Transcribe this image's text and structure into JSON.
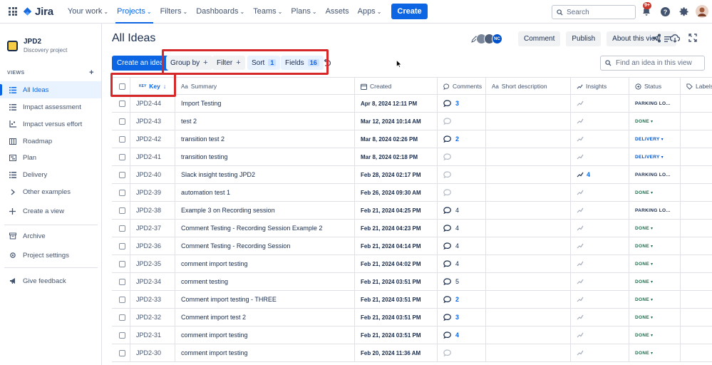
{
  "topnav": {
    "logo": "Jira",
    "items": [
      {
        "label": "Your work",
        "chevron": true
      },
      {
        "label": "Projects",
        "chevron": true,
        "active": true
      },
      {
        "label": "Filters",
        "chevron": true
      },
      {
        "label": "Dashboards",
        "chevron": true
      },
      {
        "label": "Teams",
        "chevron": true
      },
      {
        "label": "Plans",
        "chevron": true
      },
      {
        "label": "Assets",
        "chevron": false
      },
      {
        "label": "Apps",
        "chevron": true
      }
    ],
    "create": "Create",
    "search_placeholder": "Search",
    "notif_badge": "9+"
  },
  "sidebar": {
    "project_name": "JPD2",
    "project_type": "Discovery project",
    "views_header": "VIEWS",
    "views": [
      {
        "label": "All Ideas",
        "icon": "list-icon",
        "active": true
      },
      {
        "label": "Impact assessment",
        "icon": "list-icon"
      },
      {
        "label": "Impact versus effort",
        "icon": "matrix-icon"
      },
      {
        "label": "Roadmap",
        "icon": "board-icon"
      },
      {
        "label": "Plan",
        "icon": "timeline-icon"
      },
      {
        "label": "Delivery",
        "icon": "list-icon"
      },
      {
        "label": "Other examples",
        "icon": "chevron-right-icon"
      },
      {
        "label": "Create a view",
        "icon": "plus-icon"
      }
    ],
    "archive": "Archive",
    "settings": "Project settings",
    "feedback": "Give feedback"
  },
  "main": {
    "title": "All Ideas",
    "avatar_initials": "NC",
    "comment_btn": "Comment",
    "publish_btn": "Publish",
    "about_btn": "About this view",
    "create_idea": "Create an idea",
    "toolbar": {
      "group_by": "Group by",
      "filter": "Filter",
      "sort": "Sort",
      "sort_count": "1",
      "fields": "Fields",
      "fields_count": "16"
    },
    "find_placeholder": "Find an idea in this view"
  },
  "table": {
    "columns": {
      "key_prefix": "KEY",
      "key": "Key",
      "summary": "Summary",
      "created": "Created",
      "comments": "Comments",
      "short_desc": "Short description",
      "insights": "Insights",
      "status": "Status",
      "labels": "Labels"
    },
    "rows": [
      {
        "key": "JPD2-44",
        "summary": "Import Testing",
        "created": "Apr 8, 2024 12:11 PM",
        "comments": "3",
        "insights": "",
        "status": "PARKING LO..."
      },
      {
        "key": "JPD2-43",
        "summary": "test 2",
        "created": "Mar 12, 2024 10:14 AM",
        "comments": "",
        "insights": "",
        "status": "DONE"
      },
      {
        "key": "JPD2-42",
        "summary": "transition test 2",
        "created": "Mar 8, 2024 02:26 PM",
        "comments": "2",
        "insights": "",
        "status": "DELIVERY"
      },
      {
        "key": "JPD2-41",
        "summary": "transition testing",
        "created": "Mar 8, 2024 02:18 PM",
        "comments": "",
        "insights": "",
        "status": "DELIVERY"
      },
      {
        "key": "JPD2-40",
        "summary": "Slack insight testing JPD2",
        "created": "Feb 28, 2024 02:17 PM",
        "comments": "",
        "insights": "4",
        "status": "PARKING LO..."
      },
      {
        "key": "JPD2-39",
        "summary": "automation test 1",
        "created": "Feb 26, 2024 09:30 AM",
        "comments": "",
        "insights": "",
        "status": "DONE"
      },
      {
        "key": "JPD2-38",
        "summary": "Example 3 on Recording session",
        "created": "Feb 21, 2024 04:25 PM",
        "comments": "4",
        "insights": "",
        "status": "PARKING LO..."
      },
      {
        "key": "JPD2-37",
        "summary": "Comment Testing - Recording Session Example 2",
        "created": "Feb 21, 2024 04:23 PM",
        "comments": "4",
        "insights": "",
        "status": "DONE"
      },
      {
        "key": "JPD2-36",
        "summary": "Comment Testing - Recording Session",
        "created": "Feb 21, 2024 04:14 PM",
        "comments": "4",
        "insights": "",
        "status": "DONE"
      },
      {
        "key": "JPD2-35",
        "summary": "comment import testing",
        "created": "Feb 21, 2024 04:02 PM",
        "comments": "4",
        "insights": "",
        "status": "DONE"
      },
      {
        "key": "JPD2-34",
        "summary": "comment testing",
        "created": "Feb 21, 2024 03:51 PM",
        "comments": "5",
        "insights": "",
        "status": "DONE"
      },
      {
        "key": "JPD2-33",
        "summary": "Comment import testing - THREE",
        "created": "Feb 21, 2024 03:51 PM",
        "comments": "2",
        "insights": "",
        "status": "DONE"
      },
      {
        "key": "JPD2-32",
        "summary": "Comment import test 2",
        "created": "Feb 21, 2024 03:51 PM",
        "comments": "3",
        "insights": "",
        "status": "DONE"
      },
      {
        "key": "JPD2-31",
        "summary": "comment import testing",
        "created": "Feb 21, 2024 03:51 PM",
        "comments": "4",
        "insights": "",
        "status": "DONE"
      },
      {
        "key": "JPD2-30",
        "summary": "comment import testing",
        "created": "Feb 20, 2024 11:36 AM",
        "comments": "",
        "insights": "",
        "status": "DONE"
      }
    ],
    "blue_comments": [
      "3",
      "2"
    ],
    "colors": {
      "accent": "#0c66e4",
      "highlight_box": "#d62828",
      "done": "#216e4e",
      "delivery": "#0055cc"
    }
  }
}
